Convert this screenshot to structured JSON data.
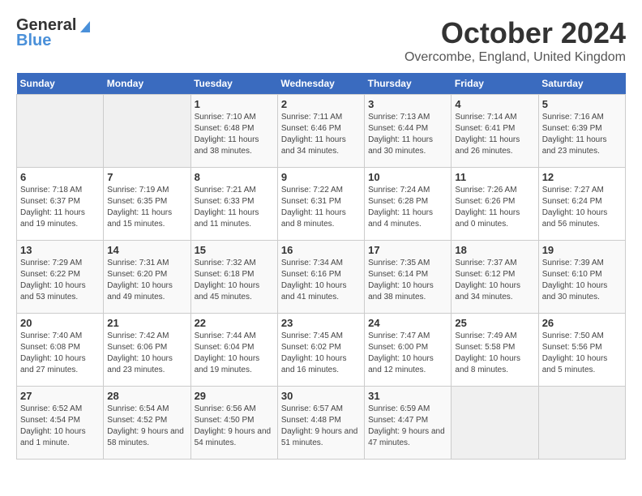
{
  "header": {
    "logo_general": "General",
    "logo_blue": "Blue",
    "title": "October 2024",
    "location": "Overcombe, England, United Kingdom"
  },
  "calendar": {
    "days_of_week": [
      "Sunday",
      "Monday",
      "Tuesday",
      "Wednesday",
      "Thursday",
      "Friday",
      "Saturday"
    ],
    "weeks": [
      [
        {
          "day": "",
          "sunrise": "",
          "sunset": "",
          "daylight": ""
        },
        {
          "day": "",
          "sunrise": "",
          "sunset": "",
          "daylight": ""
        },
        {
          "day": "1",
          "sunrise": "Sunrise: 7:10 AM",
          "sunset": "Sunset: 6:48 PM",
          "daylight": "Daylight: 11 hours and 38 minutes."
        },
        {
          "day": "2",
          "sunrise": "Sunrise: 7:11 AM",
          "sunset": "Sunset: 6:46 PM",
          "daylight": "Daylight: 11 hours and 34 minutes."
        },
        {
          "day": "3",
          "sunrise": "Sunrise: 7:13 AM",
          "sunset": "Sunset: 6:44 PM",
          "daylight": "Daylight: 11 hours and 30 minutes."
        },
        {
          "day": "4",
          "sunrise": "Sunrise: 7:14 AM",
          "sunset": "Sunset: 6:41 PM",
          "daylight": "Daylight: 11 hours and 26 minutes."
        },
        {
          "day": "5",
          "sunrise": "Sunrise: 7:16 AM",
          "sunset": "Sunset: 6:39 PM",
          "daylight": "Daylight: 11 hours and 23 minutes."
        }
      ],
      [
        {
          "day": "6",
          "sunrise": "Sunrise: 7:18 AM",
          "sunset": "Sunset: 6:37 PM",
          "daylight": "Daylight: 11 hours and 19 minutes."
        },
        {
          "day": "7",
          "sunrise": "Sunrise: 7:19 AM",
          "sunset": "Sunset: 6:35 PM",
          "daylight": "Daylight: 11 hours and 15 minutes."
        },
        {
          "day": "8",
          "sunrise": "Sunrise: 7:21 AM",
          "sunset": "Sunset: 6:33 PM",
          "daylight": "Daylight: 11 hours and 11 minutes."
        },
        {
          "day": "9",
          "sunrise": "Sunrise: 7:22 AM",
          "sunset": "Sunset: 6:31 PM",
          "daylight": "Daylight: 11 hours and 8 minutes."
        },
        {
          "day": "10",
          "sunrise": "Sunrise: 7:24 AM",
          "sunset": "Sunset: 6:28 PM",
          "daylight": "Daylight: 11 hours and 4 minutes."
        },
        {
          "day": "11",
          "sunrise": "Sunrise: 7:26 AM",
          "sunset": "Sunset: 6:26 PM",
          "daylight": "Daylight: 11 hours and 0 minutes."
        },
        {
          "day": "12",
          "sunrise": "Sunrise: 7:27 AM",
          "sunset": "Sunset: 6:24 PM",
          "daylight": "Daylight: 10 hours and 56 minutes."
        }
      ],
      [
        {
          "day": "13",
          "sunrise": "Sunrise: 7:29 AM",
          "sunset": "Sunset: 6:22 PM",
          "daylight": "Daylight: 10 hours and 53 minutes."
        },
        {
          "day": "14",
          "sunrise": "Sunrise: 7:31 AM",
          "sunset": "Sunset: 6:20 PM",
          "daylight": "Daylight: 10 hours and 49 minutes."
        },
        {
          "day": "15",
          "sunrise": "Sunrise: 7:32 AM",
          "sunset": "Sunset: 6:18 PM",
          "daylight": "Daylight: 10 hours and 45 minutes."
        },
        {
          "day": "16",
          "sunrise": "Sunrise: 7:34 AM",
          "sunset": "Sunset: 6:16 PM",
          "daylight": "Daylight: 10 hours and 41 minutes."
        },
        {
          "day": "17",
          "sunrise": "Sunrise: 7:35 AM",
          "sunset": "Sunset: 6:14 PM",
          "daylight": "Daylight: 10 hours and 38 minutes."
        },
        {
          "day": "18",
          "sunrise": "Sunrise: 7:37 AM",
          "sunset": "Sunset: 6:12 PM",
          "daylight": "Daylight: 10 hours and 34 minutes."
        },
        {
          "day": "19",
          "sunrise": "Sunrise: 7:39 AM",
          "sunset": "Sunset: 6:10 PM",
          "daylight": "Daylight: 10 hours and 30 minutes."
        }
      ],
      [
        {
          "day": "20",
          "sunrise": "Sunrise: 7:40 AM",
          "sunset": "Sunset: 6:08 PM",
          "daylight": "Daylight: 10 hours and 27 minutes."
        },
        {
          "day": "21",
          "sunrise": "Sunrise: 7:42 AM",
          "sunset": "Sunset: 6:06 PM",
          "daylight": "Daylight: 10 hours and 23 minutes."
        },
        {
          "day": "22",
          "sunrise": "Sunrise: 7:44 AM",
          "sunset": "Sunset: 6:04 PM",
          "daylight": "Daylight: 10 hours and 19 minutes."
        },
        {
          "day": "23",
          "sunrise": "Sunrise: 7:45 AM",
          "sunset": "Sunset: 6:02 PM",
          "daylight": "Daylight: 10 hours and 16 minutes."
        },
        {
          "day": "24",
          "sunrise": "Sunrise: 7:47 AM",
          "sunset": "Sunset: 6:00 PM",
          "daylight": "Daylight: 10 hours and 12 minutes."
        },
        {
          "day": "25",
          "sunrise": "Sunrise: 7:49 AM",
          "sunset": "Sunset: 5:58 PM",
          "daylight": "Daylight: 10 hours and 8 minutes."
        },
        {
          "day": "26",
          "sunrise": "Sunrise: 7:50 AM",
          "sunset": "Sunset: 5:56 PM",
          "daylight": "Daylight: 10 hours and 5 minutes."
        }
      ],
      [
        {
          "day": "27",
          "sunrise": "Sunrise: 6:52 AM",
          "sunset": "Sunset: 4:54 PM",
          "daylight": "Daylight: 10 hours and 1 minute."
        },
        {
          "day": "28",
          "sunrise": "Sunrise: 6:54 AM",
          "sunset": "Sunset: 4:52 PM",
          "daylight": "Daylight: 9 hours and 58 minutes."
        },
        {
          "day": "29",
          "sunrise": "Sunrise: 6:56 AM",
          "sunset": "Sunset: 4:50 PM",
          "daylight": "Daylight: 9 hours and 54 minutes."
        },
        {
          "day": "30",
          "sunrise": "Sunrise: 6:57 AM",
          "sunset": "Sunset: 4:48 PM",
          "daylight": "Daylight: 9 hours and 51 minutes."
        },
        {
          "day": "31",
          "sunrise": "Sunrise: 6:59 AM",
          "sunset": "Sunset: 4:47 PM",
          "daylight": "Daylight: 9 hours and 47 minutes."
        },
        {
          "day": "",
          "sunrise": "",
          "sunset": "",
          "daylight": ""
        },
        {
          "day": "",
          "sunrise": "",
          "sunset": "",
          "daylight": ""
        }
      ]
    ]
  }
}
